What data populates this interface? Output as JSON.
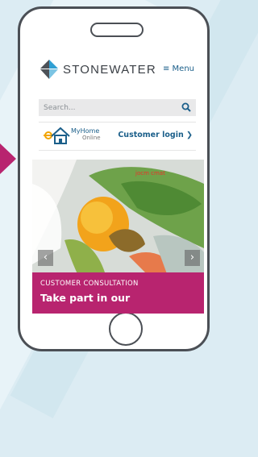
{
  "brand": {
    "name": "STONEWATER",
    "accent": "#b8246f",
    "link_color": "#1b5f8a"
  },
  "header": {
    "menu_label": "≡ Menu"
  },
  "search": {
    "placeholder": "Search...",
    "icon": "search-icon"
  },
  "login": {
    "myhome_line1": "MyHome",
    "myhome_line2": "Online",
    "customer_login_label": "Customer login ❯"
  },
  "slider": {
    "tag": "jocm cmat",
    "prev_label": "‹",
    "next_label": "›",
    "caption_label": "CUSTOMER CONSULTATION",
    "caption_title": "Take part in our"
  }
}
